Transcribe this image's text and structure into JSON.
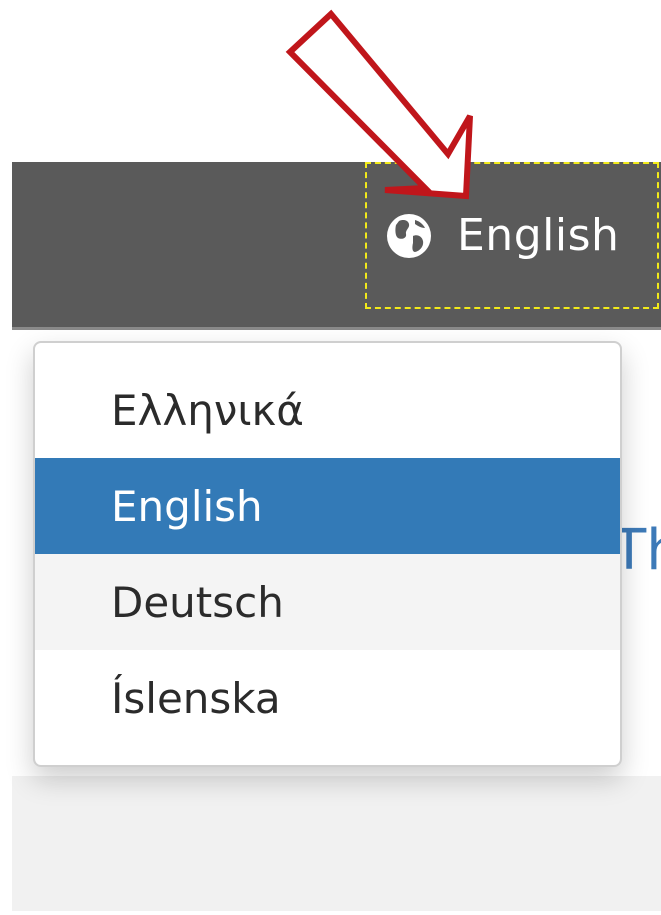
{
  "navbar": {
    "language_toggle": {
      "current_label": "English",
      "icon": "globe-icon"
    }
  },
  "language_dropdown": {
    "items": [
      {
        "label": "Ελληνικά",
        "state": "normal"
      },
      {
        "label": "English",
        "state": "selected"
      },
      {
        "label": "Deutsch",
        "state": "hover"
      },
      {
        "label": "Íslenska",
        "state": "normal"
      }
    ]
  },
  "background_page": {
    "partial_text": "Th"
  },
  "colors": {
    "navbar_bg": "#5a5a5a",
    "selected_item_bg": "#337ab7",
    "hover_item_bg": "#f4f4f4",
    "highlight_border": "#f2ea1a",
    "annotation_arrow": "#c0161b"
  }
}
